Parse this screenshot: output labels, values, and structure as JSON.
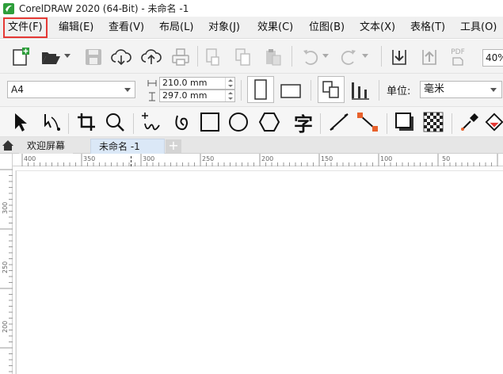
{
  "window": {
    "title": "CorelDRAW 2020 (64-Bit) - 未命名 -1",
    "logo_icon": "coreldraw-logo-icon",
    "accent_color": "#2e9e3b"
  },
  "menu": {
    "highlight_color": "#e53935",
    "items": [
      {
        "label": "文件(F)"
      },
      {
        "label": "编辑(E)"
      },
      {
        "label": "查看(V)"
      },
      {
        "label": "布局(L)"
      },
      {
        "label": "对象(J)"
      },
      {
        "label": "效果(C)"
      },
      {
        "label": "位图(B)"
      },
      {
        "label": "文本(X)"
      },
      {
        "label": "表格(T)"
      },
      {
        "label": "工具(O)"
      }
    ]
  },
  "standard_toolbar": {
    "icons": [
      "new-document-icon",
      "open-folder-icon",
      "save-icon",
      "cloud-download-icon",
      "cloud-upload-icon",
      "print-icon",
      "cut-icon",
      "copy-icon",
      "paste-icon",
      "undo-icon",
      "redo-icon",
      "import-icon",
      "export-icon",
      "publish-pdf-icon"
    ],
    "pdf_label": "PDF",
    "zoom_value": "40%"
  },
  "property_bar": {
    "page_size": "A4",
    "width_value": "210.0 mm",
    "height_value": "297.0 mm",
    "units_label": "单位:",
    "units_value": "毫米"
  },
  "toolbox": {
    "text_tool_glyph": "字",
    "icons": [
      "pick-tool-icon",
      "shape-tool-icon",
      "crop-tool-icon",
      "zoom-tool-icon",
      "freehand-tool-icon",
      "artistic-media-icon",
      "rectangle-tool-icon",
      "ellipse-tool-icon",
      "polygon-tool-icon",
      "text-tool-icon",
      "parallel-dimension-icon",
      "connector-tool-icon",
      "drop-shadow-icon",
      "transparency-icon",
      "eyedropper-icon",
      "interactive-fill-icon"
    ]
  },
  "tabs": {
    "welcome": "欢迎屏幕",
    "document": "未命名 -1",
    "add": "+"
  },
  "ruler": {
    "horizontal_labels": [
      "400",
      "350",
      "300",
      "250",
      "200",
      "150",
      "100",
      "50"
    ],
    "vertical_labels": [
      "300",
      "250",
      "200"
    ]
  }
}
